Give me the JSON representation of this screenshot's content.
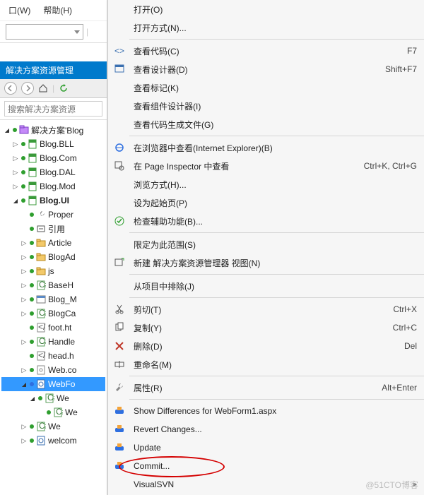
{
  "menubar": {
    "window": "口(W)",
    "help": "帮助(H)"
  },
  "panel": {
    "title": "解决方案资源管理",
    "search_placeholder": "搜索解决方案资源"
  },
  "tree": {
    "solution": "解决方案'Blog",
    "items": [
      {
        "label": "Blog.BLL"
      },
      {
        "label": "Blog.Com"
      },
      {
        "label": "Blog.DAL"
      },
      {
        "label": "Blog.Mod"
      }
    ],
    "ui": {
      "label": "Blog.UI",
      "children": [
        {
          "label": "Proper",
          "kind": "wrench"
        },
        {
          "label": "引用",
          "kind": "ref"
        },
        {
          "label": "Article",
          "kind": "folder"
        },
        {
          "label": "BlogAd",
          "kind": "folder"
        },
        {
          "label": "js",
          "kind": "folder"
        },
        {
          "label": "BaseH",
          "kind": "cs"
        },
        {
          "label": "Blog_M",
          "kind": "master"
        },
        {
          "label": "BlogCa",
          "kind": "cs"
        },
        {
          "label": "foot.ht",
          "kind": "html"
        },
        {
          "label": "Handle",
          "kind": "cs"
        },
        {
          "label": "head.h",
          "kind": "html"
        },
        {
          "label": "Web.co",
          "kind": "config"
        },
        {
          "label": "WebFo",
          "kind": "aspx",
          "selected": true
        },
        {
          "label": "We",
          "kind": "cs",
          "child": "We"
        },
        {
          "label": "welcom",
          "kind": "aspx"
        }
      ]
    }
  },
  "ctx_groups": [
    [
      {
        "icon": "",
        "label": "打开(O)"
      },
      {
        "icon": "",
        "label": "打开方式(N)...",
        "sub": false
      }
    ],
    [
      {
        "icon": "code",
        "label": "查看代码(C)",
        "shortcut": "F7"
      },
      {
        "icon": "design",
        "label": "查看设计器(D)",
        "shortcut": "Shift+F7"
      },
      {
        "icon": "",
        "label": "查看标记(K)"
      },
      {
        "icon": "",
        "label": "查看组件设计器(I)"
      },
      {
        "icon": "",
        "label": "查看代码生成文件(G)"
      }
    ],
    [
      {
        "icon": "ie",
        "label": "在浏览器中查看(Internet Explorer)(B)"
      },
      {
        "icon": "inspect",
        "label": "在 Page Inspector 中查看",
        "shortcut": "Ctrl+K, Ctrl+G"
      },
      {
        "icon": "",
        "label": "浏览方式(H)...",
        "sub": false
      },
      {
        "icon": "",
        "label": "设为起始页(P)"
      },
      {
        "icon": "check",
        "label": "检查辅助功能(B)...",
        "sub": false
      }
    ],
    [
      {
        "icon": "",
        "label": "限定为此范围(S)"
      },
      {
        "icon": "newview",
        "label": "新建 解决方案资源管理器 视图(N)"
      }
    ],
    [
      {
        "icon": "",
        "label": "从项目中排除(J)"
      }
    ],
    [
      {
        "icon": "cut",
        "label": "剪切(T)",
        "shortcut": "Ctrl+X"
      },
      {
        "icon": "copy",
        "label": "复制(Y)",
        "shortcut": "Ctrl+C"
      },
      {
        "icon": "del",
        "label": "删除(D)",
        "shortcut": "Del"
      },
      {
        "icon": "rename",
        "label": "重命名(M)"
      }
    ],
    [
      {
        "icon": "prop",
        "label": "属性(R)",
        "shortcut": "Alt+Enter"
      }
    ],
    [
      {
        "icon": "svn",
        "label": "Show Differences for WebForm1.aspx"
      },
      {
        "icon": "svn",
        "label": "Revert Changes...",
        "sub": false
      },
      {
        "icon": "svn",
        "label": "Update"
      },
      {
        "icon": "svn",
        "label": "Commit...",
        "sub": false
      },
      {
        "icon": "",
        "label": "VisualSVN",
        "sub": true
      }
    ]
  ],
  "watermark": "@51CTO博客"
}
